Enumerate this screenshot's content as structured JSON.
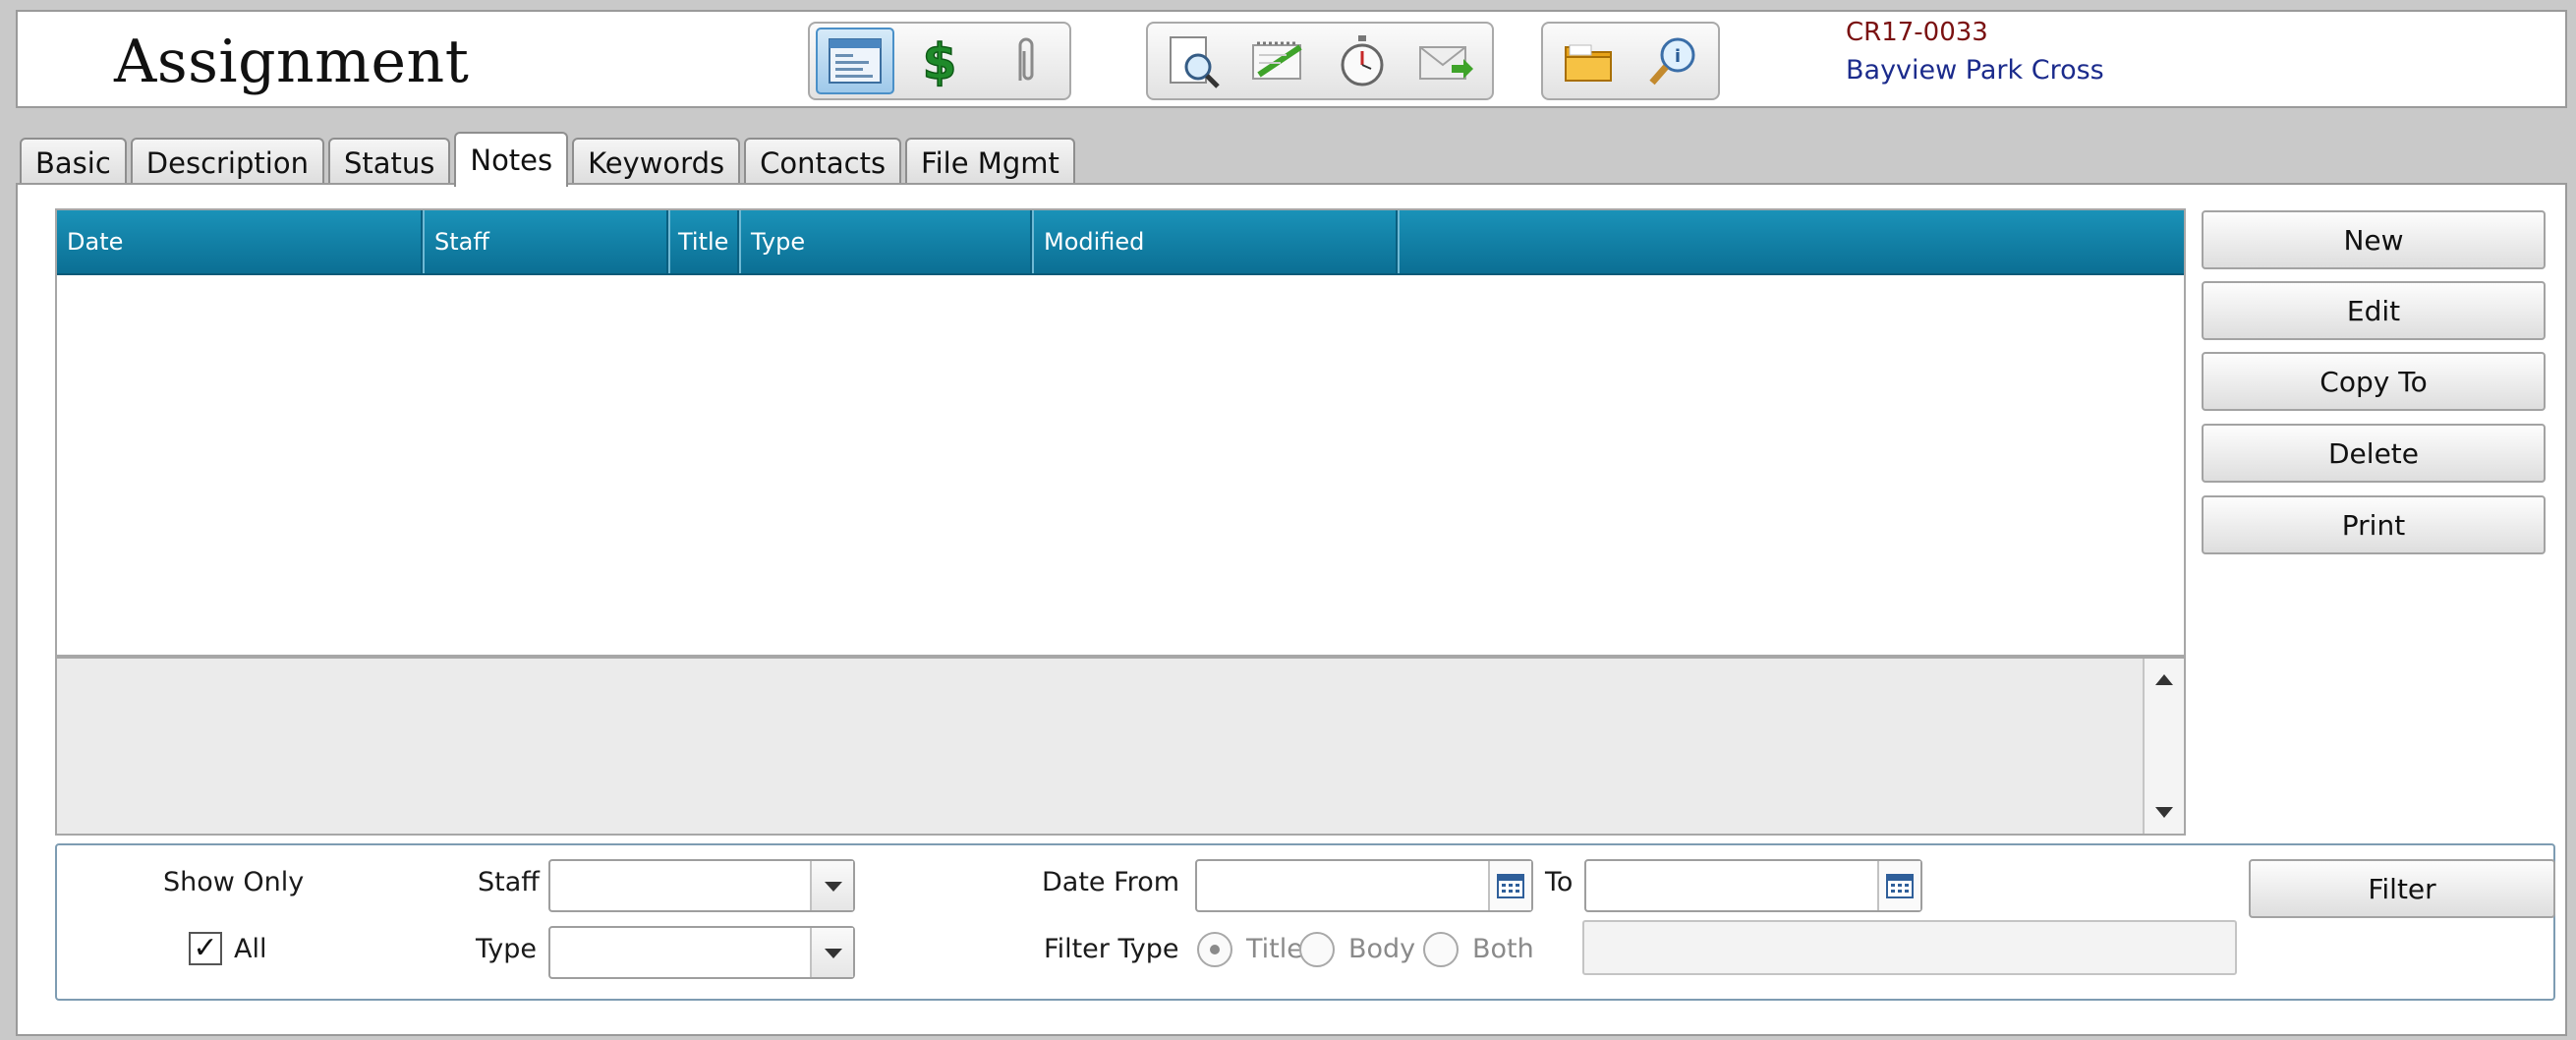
{
  "header": {
    "title": "Assignment",
    "case_number": "CR17-0033",
    "case_name": "Bayview Park Cross",
    "toolbar_groups": [
      [
        "window-icon",
        "dollar-icon",
        "paperclip-icon"
      ],
      [
        "document-search-icon",
        "notepad-icon",
        "stopwatch-icon",
        "mail-forward-icon"
      ],
      [
        "folder-icon",
        "magnifier-info-icon"
      ]
    ]
  },
  "tabs": [
    {
      "label": "Basic"
    },
    {
      "label": "Description"
    },
    {
      "label": "Status"
    },
    {
      "label": "Notes",
      "active": true
    },
    {
      "label": "Keywords"
    },
    {
      "label": "Contacts"
    },
    {
      "label": "File Mgmt"
    }
  ],
  "grid": {
    "columns": [
      "Date",
      "Staff",
      "Title",
      "Type",
      "Modified",
      ""
    ]
  },
  "actions": {
    "new": "New",
    "edit": "Edit",
    "copy_to": "Copy To",
    "delete": "Delete",
    "print": "Print"
  },
  "filter": {
    "show_only_label": "Show Only",
    "all_label": "All",
    "all_checked": true,
    "staff_label": "Staff",
    "staff_value": "",
    "type_label": "Type",
    "type_value": "",
    "date_from_label": "Date From",
    "date_from_value": "",
    "to_label": "To",
    "date_to_value": "",
    "filter_type_label": "Filter Type",
    "filter_type_options": [
      "Title",
      "Body",
      "Both"
    ],
    "filter_type_selected": "Title",
    "search_text": "",
    "filter_button": "Filter"
  },
  "colors": {
    "grid_header": "#0f7ea3",
    "case_number": "#7a1111",
    "case_name": "#1b2b8c"
  }
}
